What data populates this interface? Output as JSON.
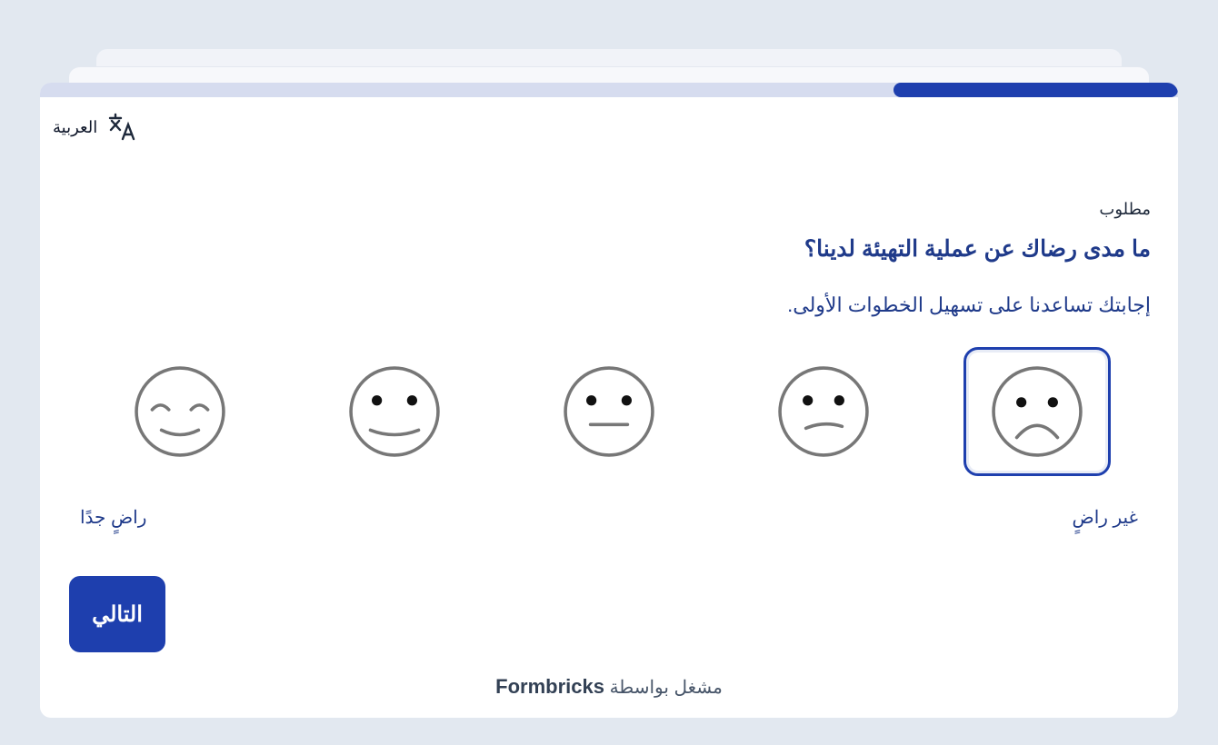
{
  "survey": {
    "progress_percent": 25,
    "language_label": "العربية",
    "language_icon": "translate-icon",
    "required_label": "مطلوب",
    "question": "ما مدى رضاك عن عملية التهيئة لدينا؟",
    "subheader": "إجابتك تساعدنا على تسهيل الخطوات الأولى.",
    "rating": {
      "options": [
        {
          "face": "frowning-face-icon",
          "value": 1
        },
        {
          "face": "slightly-frowning-face-icon",
          "value": 2
        },
        {
          "face": "neutral-face-icon",
          "value": 3
        },
        {
          "face": "slightly-smiling-face-icon",
          "value": 4
        },
        {
          "face": "smiling-eyes-face-icon",
          "value": 5
        }
      ],
      "selected_value": 1,
      "low_label": "غير راضٍ",
      "high_label": "راضٍ جدًا"
    },
    "next_button": "التالي",
    "footer_prefix": "مشغل بواسطة",
    "footer_brand": "Formbricks"
  },
  "colors": {
    "accent": "#1e3fae",
    "question_text": "#1f3a8a",
    "background": "#e2e8f0",
    "face_stroke": "#777777"
  }
}
